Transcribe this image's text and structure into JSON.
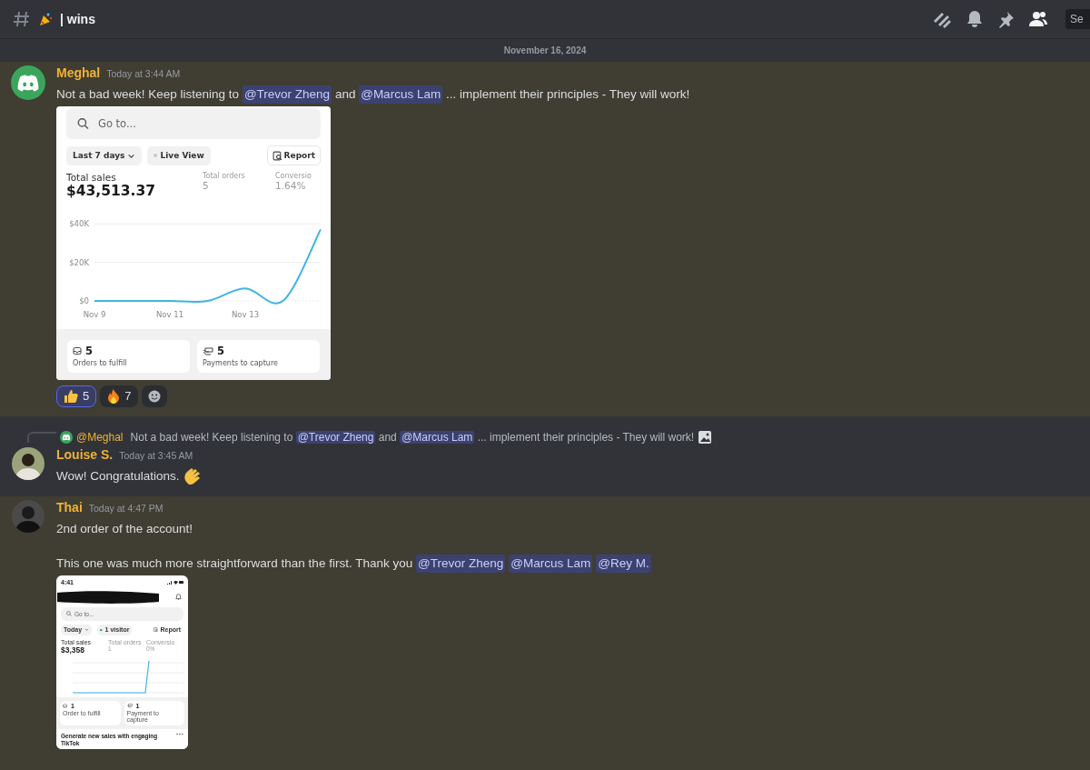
{
  "header": {
    "channel_name": "| wins",
    "search_placeholder": "Se"
  },
  "date_divider": "November 16, 2024",
  "messages": [
    {
      "kind": "plain",
      "author": "Meghal",
      "default_avatar": true,
      "timestamp": "Today at 3:44 AM",
      "highlighted": true,
      "lines": [
        [
          {
            "kind": "text",
            "text": "Not a bad week! Keep listening to "
          },
          {
            "kind": "mention",
            "text": "@Trevor Zheng"
          },
          {
            "kind": "text",
            "text": " and "
          },
          {
            "kind": "mention",
            "text": "@Marcus Lam"
          },
          {
            "kind": "text",
            "text": " ... implement their principles - They will work!"
          }
        ]
      ],
      "attachment": {
        "kind": "desktop",
        "search": {
          "placeholder": "Go to..."
        },
        "filters": [
          {
            "kind": "dropdown",
            "label": "Last 7 days"
          },
          {
            "kind": "status",
            "label": "Live View"
          }
        ],
        "report_button": "Report",
        "metrics": [
          {
            "kind": "primary",
            "label": "Total sales",
            "value": "$43,513.37"
          },
          {
            "kind": "secondary",
            "label": "Total orders",
            "value": "5"
          },
          {
            "kind": "secondary",
            "label": "Conversio",
            "value": "1.64%"
          }
        ],
        "chart_data": {
          "type": "line",
          "categories": [
            "Nov 9",
            null,
            "Nov 11",
            null,
            "Nov 13",
            null,
            null
          ],
          "series": [
            {
              "color": "#3fb4e0",
              "values": [
                0,
                0,
                0,
                0,
                6500,
                0,
                37000
              ]
            }
          ],
          "ylim": [
            0,
            40000
          ],
          "yticks": [
            {
              "value": 0,
              "label": "$0"
            },
            {
              "value": 20000,
              "label": "$20K"
            },
            {
              "value": 40000,
              "label": "$40K"
            }
          ]
        },
        "tasks": [
          {
            "kind": "inbox",
            "count": "5",
            "label": "Orders to fulfill"
          },
          {
            "kind": "payment",
            "count": "5",
            "label": "Payments to capture"
          }
        ]
      },
      "reactions": [
        {
          "kind": "thumbs-up",
          "count": "5",
          "selected": true
        },
        {
          "kind": "fire",
          "count": "7",
          "selected": false
        }
      ]
    },
    {
      "kind": "reply",
      "author": "Louise S.",
      "default_avatar": false,
      "timestamp": "Today at 3:45 AM",
      "highlighted": false,
      "reply_to": {
        "author": "@Meghal",
        "parts": [
          {
            "kind": "text",
            "text": "Not a bad week! Keep listening to "
          },
          {
            "kind": "mention",
            "text": "@Trevor Zheng"
          },
          {
            "kind": "text",
            "text": " and "
          },
          {
            "kind": "mention",
            "text": "@Marcus Lam"
          },
          {
            "kind": "text",
            "text": " ... implement their principles - They will work!"
          }
        ]
      },
      "lines": [
        [
          {
            "kind": "text",
            "text": "Wow! Congratulations. "
          },
          {
            "kind": "clap"
          }
        ]
      ]
    },
    {
      "kind": "plain",
      "author": "Thai",
      "default_avatar": false,
      "timestamp": "Today at 4:47 PM",
      "highlighted": true,
      "lines": [
        [
          {
            "kind": "text",
            "text": "2nd order of the account!"
          }
        ],
        [
          {
            "kind": "text",
            "text": "This one was much more straightforward than the first. Thank you "
          },
          {
            "kind": "mention",
            "text": "@Trevor Zheng"
          },
          {
            "kind": "mention",
            "text": "@Marcus Lam"
          },
          {
            "kind": "mention",
            "text": "@Rey M."
          }
        ]
      ],
      "attachment": {
        "kind": "mobile",
        "time": "4:41",
        "search": {
          "placeholder": "Go to..."
        },
        "filters": [
          {
            "kind": "dropdown",
            "label": "Today"
          },
          {
            "kind": "status",
            "label": "1 visitor"
          }
        ],
        "report_button": "Report",
        "metrics": [
          {
            "kind": "primary",
            "label": "Total sales",
            "value": "$3,358"
          },
          {
            "kind": "secondary",
            "label": "Total orders",
            "value": "1"
          },
          {
            "kind": "secondary",
            "label": "Conversio",
            "value": "0%"
          }
        ],
        "tasks": [
          {
            "kind": "inbox",
            "count": "1",
            "label": "Order to fulfill"
          },
          {
            "kind": "payment",
            "count": "1",
            "label": "Payment to capture"
          }
        ],
        "promo": "Generate new sales with engaging TikTok"
      }
    }
  ]
}
